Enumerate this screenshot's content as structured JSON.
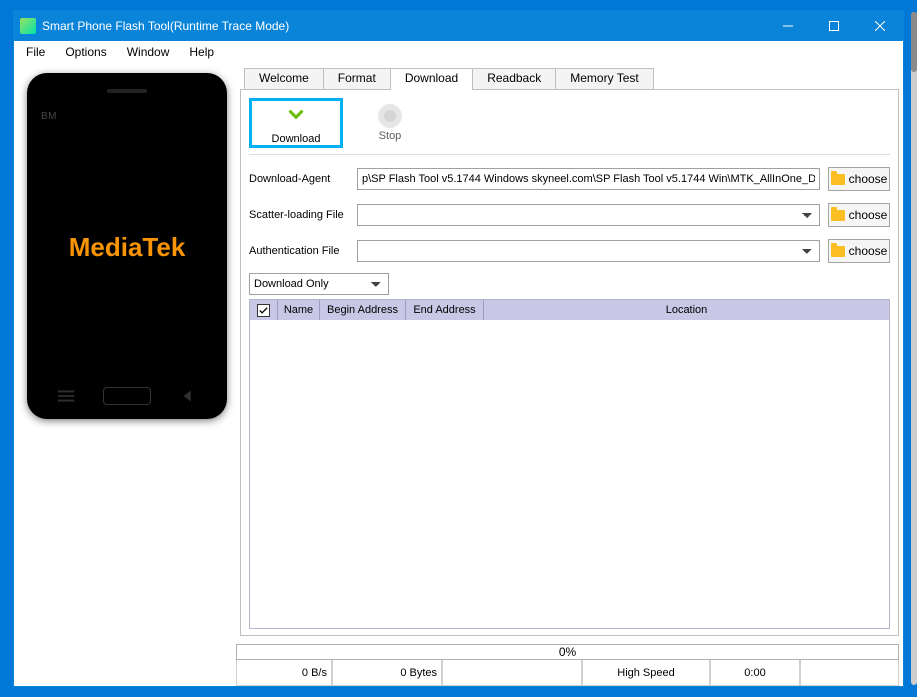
{
  "window": {
    "title": "Smart Phone Flash Tool(Runtime Trace Mode)"
  },
  "menu": {
    "file": "File",
    "options": "Options",
    "window": "Window",
    "help": "Help"
  },
  "phone": {
    "bm": "BM",
    "brand": "MediaTek"
  },
  "tabs": {
    "welcome": "Welcome",
    "format": "Format",
    "download": "Download",
    "readback": "Readback",
    "memtest": "Memory Test"
  },
  "toolbar": {
    "download": "Download",
    "stop": "Stop"
  },
  "fields": {
    "download_agent_label": "Download-Agent",
    "download_agent_value": "p\\SP Flash Tool v5.1744 Windows skyneel.com\\SP Flash Tool v5.1744 Win\\MTK_AllInOne_DA.bin",
    "scatter_label": "Scatter-loading File",
    "scatter_value": "",
    "auth_label": "Authentication File",
    "auth_value": "",
    "choose": "choose",
    "mode": "Download Only"
  },
  "table": {
    "headers": {
      "name": "Name",
      "begin": "Begin Address",
      "end": "End Address",
      "location": "Location"
    }
  },
  "status": {
    "percent": "0%",
    "speed": "0 B/s",
    "bytes": "0 Bytes",
    "mode": "High Speed",
    "time": "0:00"
  }
}
